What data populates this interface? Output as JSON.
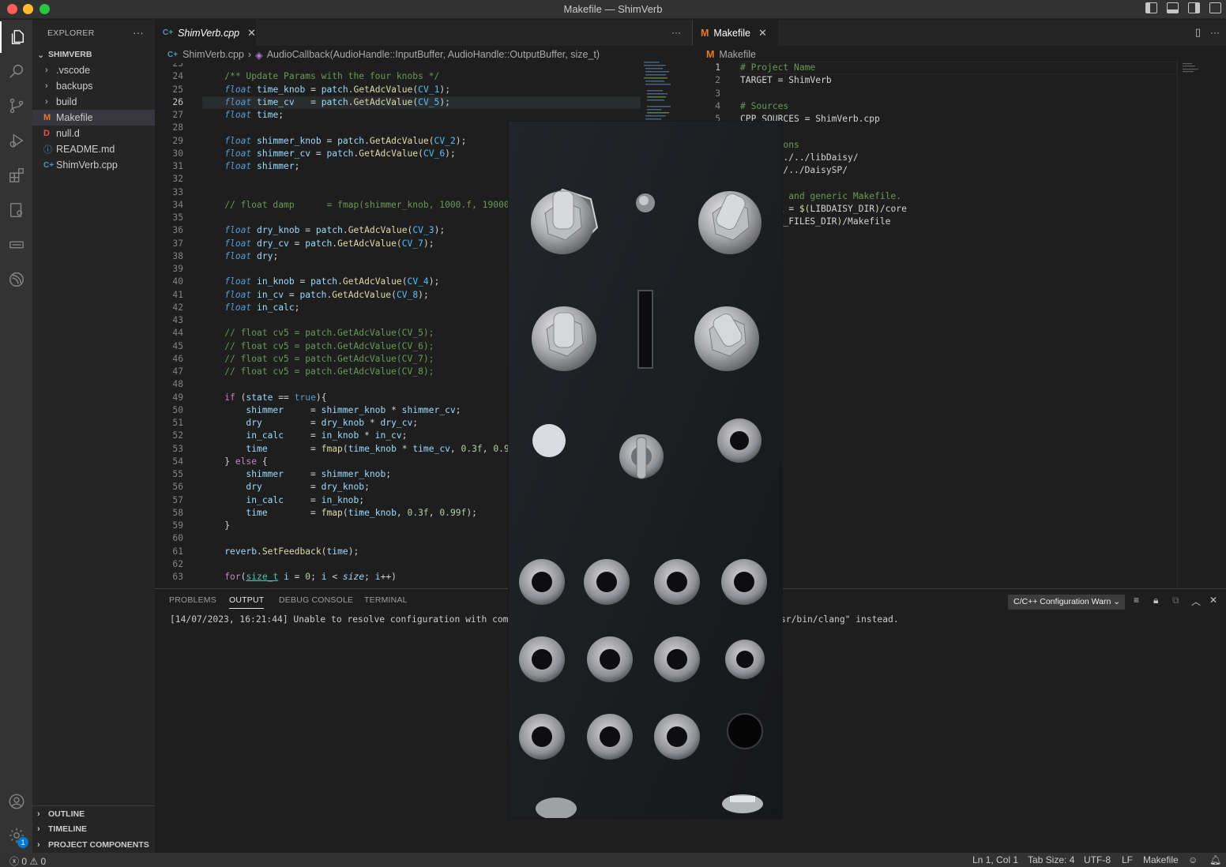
{
  "window": {
    "title": "Makefile — ShimVerb"
  },
  "sidebar": {
    "header": "EXPLORER",
    "more": "···",
    "folder": "SHIMVERB",
    "items": [
      {
        "label": ".vscode",
        "type": "folder",
        "icon": "chevron-right"
      },
      {
        "label": "backups",
        "type": "folder",
        "icon": "chevron-right"
      },
      {
        "label": "build",
        "type": "folder",
        "icon": "chevron-right"
      },
      {
        "label": "Makefile",
        "type": "file",
        "icon_text": "M",
        "icon_color": "#e37933",
        "selected": true
      },
      {
        "label": "null.d",
        "type": "file",
        "icon_text": "D",
        "icon_color": "#e5534b"
      },
      {
        "label": "README.md",
        "type": "file",
        "icon_text": "ⓘ",
        "icon_color": "#519aba"
      },
      {
        "label": "ShimVerb.cpp",
        "type": "file",
        "icon_text": "C+",
        "icon_color": "#519aba"
      }
    ],
    "bottom_sections": [
      "OUTLINE",
      "TIMELINE",
      "PROJECT COMPONENTS"
    ]
  },
  "left_editor": {
    "tab": {
      "label": "ShimVerb.cpp",
      "icon_text": "C+",
      "italic": true
    },
    "more": "···",
    "breadcrumb": {
      "file": "ShimVerb.cpp",
      "symbol": "AudioCallback(AudioHandle::InputBuffer, AudioHandle::OutputBuffer, size_t)"
    },
    "current_line": 26,
    "lines": [
      {
        "n": "23",
        "html": ""
      },
      {
        "n": "24",
        "html": "    <span style=\"color:#6a9955\">/** Update Params with the four knobs */</span>"
      },
      {
        "n": "25",
        "html": "    <span style=\"color:#569cd6;font-style:italic\">float</span> <span style=\"color:#9cdcfe\">time_knob</span> <span style=\"color:#d4d4d4\">=</span> <span style=\"color:#9cdcfe\">patch</span>.<span style=\"color:#dcdcaa\">GetAdcValue</span>(<span style=\"color:#4fc1ff\">CV_1</span>);"
      },
      {
        "n": "26",
        "html": "    <span style=\"color:#569cd6;font-style:italic\">float</span> <span style=\"color:#9cdcfe\">time_cv</span>   <span style=\"color:#d4d4d4\">=</span> <span style=\"color:#9cdcfe\">patch</span>.<span style=\"color:#dcdcaa\">GetAdcValue</span>(<span style=\"color:#4fc1ff\">CV_5</span>);"
      },
      {
        "n": "27",
        "html": "    <span style=\"color:#569cd6;font-style:italic\">float</span> <span style=\"color:#9cdcfe\">time</span>;"
      },
      {
        "n": "28",
        "html": ""
      },
      {
        "n": "29",
        "html": "    <span style=\"color:#569cd6;font-style:italic\">float</span> <span style=\"color:#9cdcfe\">shimmer_knob</span> = <span style=\"color:#9cdcfe\">patch</span>.<span style=\"color:#dcdcaa\">GetAdcValue</span>(<span style=\"color:#4fc1ff\">CV_2</span>);"
      },
      {
        "n": "30",
        "html": "    <span style=\"color:#569cd6;font-style:italic\">float</span> <span style=\"color:#9cdcfe\">shimmer_cv</span> = <span style=\"color:#9cdcfe\">patch</span>.<span style=\"color:#dcdcaa\">GetAdcValue</span>(<span style=\"color:#4fc1ff\">CV_6</span>);"
      },
      {
        "n": "31",
        "html": "    <span style=\"color:#569cd6;font-style:italic\">float</span> <span style=\"color:#9cdcfe\">shimmer</span>;"
      },
      {
        "n": "32",
        "html": ""
      },
      {
        "n": "33",
        "html": ""
      },
      {
        "n": "34",
        "html": "    <span style=\"color:#6a9955\">// float damp      = fmap(shimmer_knob, 1000.f, 19000.f,</span>"
      },
      {
        "n": "35",
        "html": ""
      },
      {
        "n": "36",
        "html": "    <span style=\"color:#569cd6;font-style:italic\">float</span> <span style=\"color:#9cdcfe\">dry_knob</span> = <span style=\"color:#9cdcfe\">patch</span>.<span style=\"color:#dcdcaa\">GetAdcValue</span>(<span style=\"color:#4fc1ff\">CV_3</span>);"
      },
      {
        "n": "37",
        "html": "    <span style=\"color:#569cd6;font-style:italic\">float</span> <span style=\"color:#9cdcfe\">dry_cv</span> = <span style=\"color:#9cdcfe\">patch</span>.<span style=\"color:#dcdcaa\">GetAdcValue</span>(<span style=\"color:#4fc1ff\">CV_7</span>);"
      },
      {
        "n": "38",
        "html": "    <span style=\"color:#569cd6;font-style:italic\">float</span> <span style=\"color:#9cdcfe\">dry</span>;"
      },
      {
        "n": "39",
        "html": ""
      },
      {
        "n": "40",
        "html": "    <span style=\"color:#569cd6;font-style:italic\">float</span> <span style=\"color:#9cdcfe\">in_knob</span> = <span style=\"color:#9cdcfe\">patch</span>.<span style=\"color:#dcdcaa\">GetAdcValue</span>(<span style=\"color:#4fc1ff\">CV_4</span>);"
      },
      {
        "n": "41",
        "html": "    <span style=\"color:#569cd6;font-style:italic\">float</span> <span style=\"color:#9cdcfe\">in_cv</span> = <span style=\"color:#9cdcfe\">patch</span>.<span style=\"color:#dcdcaa\">GetAdcValue</span>(<span style=\"color:#4fc1ff\">CV_8</span>);"
      },
      {
        "n": "42",
        "html": "    <span style=\"color:#569cd6;font-style:italic\">float</span> <span style=\"color:#9cdcfe\">in_calc</span>;"
      },
      {
        "n": "43",
        "html": ""
      },
      {
        "n": "44",
        "html": "    <span style=\"color:#6a9955\">// float cv5 = patch.GetAdcValue(CV_5);</span>"
      },
      {
        "n": "45",
        "html": "    <span style=\"color:#6a9955\">// float cv5 = patch.GetAdcValue(CV_6);</span>"
      },
      {
        "n": "46",
        "html": "    <span style=\"color:#6a9955\">// float cv5 = patch.GetAdcValue(CV_7);</span>"
      },
      {
        "n": "47",
        "html": "    <span style=\"color:#6a9955\">// float cv5 = patch.GetAdcValue(CV_8);</span>"
      },
      {
        "n": "48",
        "html": ""
      },
      {
        "n": "49",
        "html": "    <span style=\"color:#c586c0\">if</span> (<span style=\"color:#9cdcfe\">state</span> == <span style=\"color:#569cd6\">true</span>){"
      },
      {
        "n": "50",
        "html": "        <span style=\"color:#9cdcfe\">shimmer</span>     = <span style=\"color:#9cdcfe\">shimmer_knob</span> * <span style=\"color:#9cdcfe\">shimmer_cv</span>;"
      },
      {
        "n": "51",
        "html": "        <span style=\"color:#9cdcfe\">dry</span>         = <span style=\"color:#9cdcfe\">dry_knob</span> * <span style=\"color:#9cdcfe\">dry_cv</span>;"
      },
      {
        "n": "52",
        "html": "        <span style=\"color:#9cdcfe\">in_calc</span>     = <span style=\"color:#9cdcfe\">in_knob</span> * <span style=\"color:#9cdcfe\">in_cv</span>;"
      },
      {
        "n": "53",
        "html": "        <span style=\"color:#9cdcfe\">time</span>        = <span style=\"color:#dcdcaa\">fmap</span>(<span style=\"color:#9cdcfe\">time_knob</span> * <span style=\"color:#9cdcfe\">time_cv</span>, <span style=\"color:#b5cea8\">0.3f</span>, <span style=\"color:#b5cea8\">0.99f</span>"
      },
      {
        "n": "54",
        "html": "    } <span style=\"color:#c586c0\">else</span> {"
      },
      {
        "n": "55",
        "html": "        <span style=\"color:#9cdcfe\">shimmer</span>     = <span style=\"color:#9cdcfe\">shimmer_knob</span>;"
      },
      {
        "n": "56",
        "html": "        <span style=\"color:#9cdcfe\">dry</span>         = <span style=\"color:#9cdcfe\">dry_knob</span>;"
      },
      {
        "n": "57",
        "html": "        <span style=\"color:#9cdcfe\">in_calc</span>     = <span style=\"color:#9cdcfe\">in_knob</span>;"
      },
      {
        "n": "58",
        "html": "        <span style=\"color:#9cdcfe\">time</span>        = <span style=\"color:#dcdcaa\">fmap</span>(<span style=\"color:#9cdcfe\">time_knob</span>, <span style=\"color:#b5cea8\">0.3f</span>, <span style=\"color:#b5cea8\">0.99f</span>);"
      },
      {
        "n": "59",
        "html": "    }"
      },
      {
        "n": "60",
        "html": ""
      },
      {
        "n": "61",
        "html": "    <span style=\"color:#9cdcfe\">reverb</span>.<span style=\"color:#dcdcaa\">SetFeedback</span>(<span style=\"color:#9cdcfe\">time</span>);"
      },
      {
        "n": "62",
        "html": ""
      },
      {
        "n": "63",
        "html": "    <span style=\"color:#c586c0\">for</span>(<span style=\"color:#4ec9b0;text-decoration:underline\">size_t</span> <span style=\"color:#9cdcfe\">i</span> = <span style=\"color:#b5cea8\">0</span>; <span style=\"color:#9cdcfe\">i</span> &lt; <span style=\"color:#9cdcfe;font-style:italic\">size</span>; <span style=\"color:#9cdcfe\">i</span>++)"
      }
    ]
  },
  "right_editor": {
    "tab": {
      "label": "Makefile",
      "icon_text": "M"
    },
    "breadcrumb": {
      "file": "Makefile"
    },
    "lines": [
      {
        "n": "1",
        "html": "<span style=\"color:#6a9955\"># Project Name</span>"
      },
      {
        "n": "2",
        "html": "TARGET = ShimVerb"
      },
      {
        "n": "3",
        "html": ""
      },
      {
        "n": "4",
        "html": "<span style=\"color:#6a9955\"># Sources</span>"
      },
      {
        "n": "5",
        "html": "CPP_SOURCES = ShimVerb.cpp"
      },
      {
        "n": "6",
        "html": ""
      },
      {
        "n": "7",
        "html": "<span style=\"color:#6a9955\">y Locations</span>"
      },
      {
        "n": "8",
        "html": "_DIR = ../../libDaisy/"
      },
      {
        "n": "9",
        "html": "DIR = ../../DaisySP/"
      },
      {
        "n": "10",
        "html": ""
      },
      {
        "n": "11",
        "html": "<span style=\"color:#6a9955\">ocation, and generic Makefile.</span>"
      },
      {
        "n": "12",
        "html": "ILES_DIR = <span style=\"color:#dcdcaa\">$(</span>LIBDAISY_DIR<span style=\"color:#dcdcaa\">)</span>/core"
      },
      {
        "n": "13",
        "html": "<span style=\"color:#dcdcaa\">$(</span>SYSTEM_FILES_DIR<span style=\"color:#dcdcaa\">)</span>/Makefile"
      }
    ]
  },
  "panel": {
    "tabs": [
      "PROBLEMS",
      "OUTPUT",
      "DEBUG CONSOLE",
      "TERMINAL"
    ],
    "active_tab": "OUTPUT",
    "channel": "C/C++ Configuration Warn",
    "output_left": "[14/07/2023, 16:21:44] Unable to resolve configuration with compil",
    "output_right": "sr/bin/clang\" instead."
  },
  "statusbar": {
    "problems": "0",
    "warnings": "0",
    "position": "Ln 1, Col 1",
    "tab_size": "Tab Size: 4",
    "encoding": "UTF-8",
    "eol": "LF",
    "language": "Makefile"
  },
  "activity_badge": "1",
  "colors": {
    "accent": "#0078d4",
    "makefile_icon": "#e37933",
    "cpp_icon": "#519aba"
  }
}
